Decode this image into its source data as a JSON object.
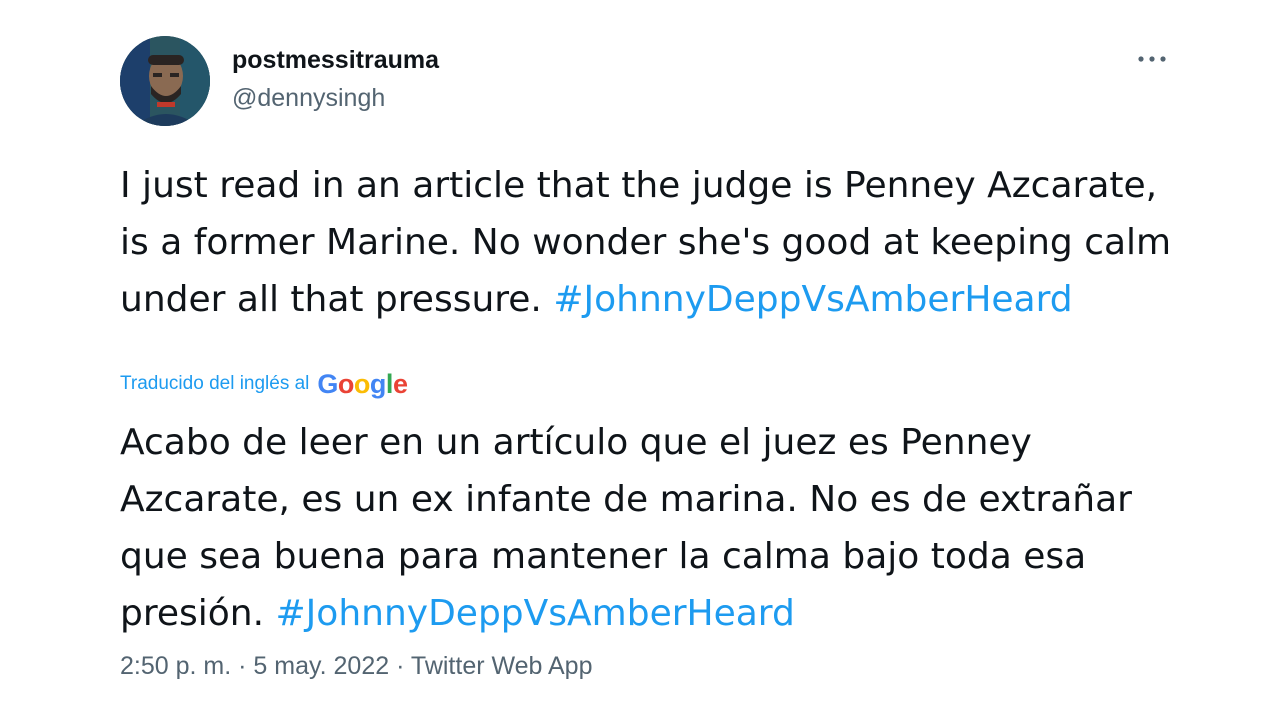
{
  "author": {
    "display_name": "postmessitrauma",
    "handle": "@dennysingh",
    "avatar_icon": "user-avatar"
  },
  "more_icon": "more-horizontal-icon",
  "tweet": {
    "original_text": "I just read in an article that the judge is Penney Azcarate, is a former Marine. No wonder she's good at keeping calm under all that pressure.",
    "original_hashtag": "#JohnnyDeppVsAmberHeard",
    "translated_label": "Traducido del inglés al",
    "translation_provider": "Google",
    "translated_text": "Acabo de leer en un artículo que el juez es Penney Azcarate, es un ex infante de marina. No es de extrañar que sea buena para mantener la calma bajo toda esa presión.",
    "translated_hashtag": "#JohnnyDeppVsAmberHeard"
  },
  "meta": {
    "time": "2:50 p. m.",
    "separator": "·",
    "date": "5 may. 2022",
    "source": "Twitter Web App"
  },
  "colors": {
    "link": "#1d9bf0",
    "secondary": "#536471",
    "text": "#0f1419",
    "google_blue": "#4285f4",
    "google_red": "#ea4335",
    "google_yellow": "#fbbc05",
    "google_green": "#34a853"
  }
}
